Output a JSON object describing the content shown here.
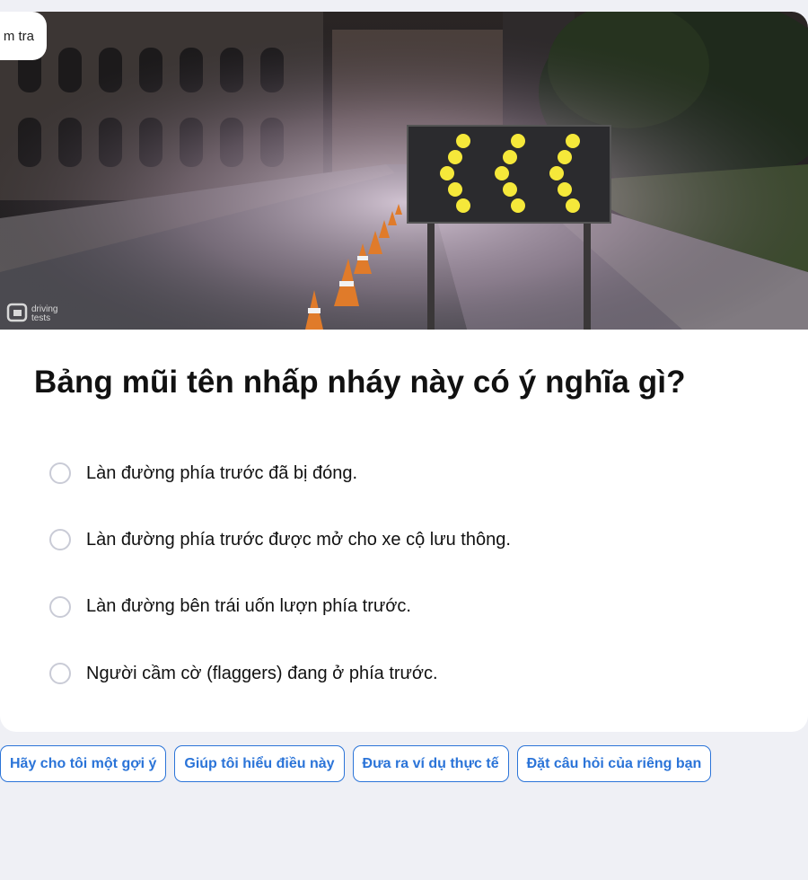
{
  "badge": {
    "label": "m tra"
  },
  "image": {
    "watermark_line1": "driving",
    "watermark_line2": "tests"
  },
  "question": {
    "text": "Bảng mũi tên nhấp nháy này có ý nghĩa gì?"
  },
  "options": [
    {
      "label": "Làn đường phía trước đã bị đóng."
    },
    {
      "label": "Làn đường phía trước được mở cho xe cộ lưu thông."
    },
    {
      "label": "Làn đường bên trái uốn lượn phía trước."
    },
    {
      "label": "Người cầm cờ (flaggers) đang ở phía trước."
    }
  ],
  "chips": [
    {
      "label": "Hãy cho tôi một gợi ý"
    },
    {
      "label": "Giúp tôi hiểu điều này"
    },
    {
      "label": "Đưa ra ví dụ thực tế"
    },
    {
      "label": "Đặt câu hỏi của riêng bạn"
    }
  ]
}
